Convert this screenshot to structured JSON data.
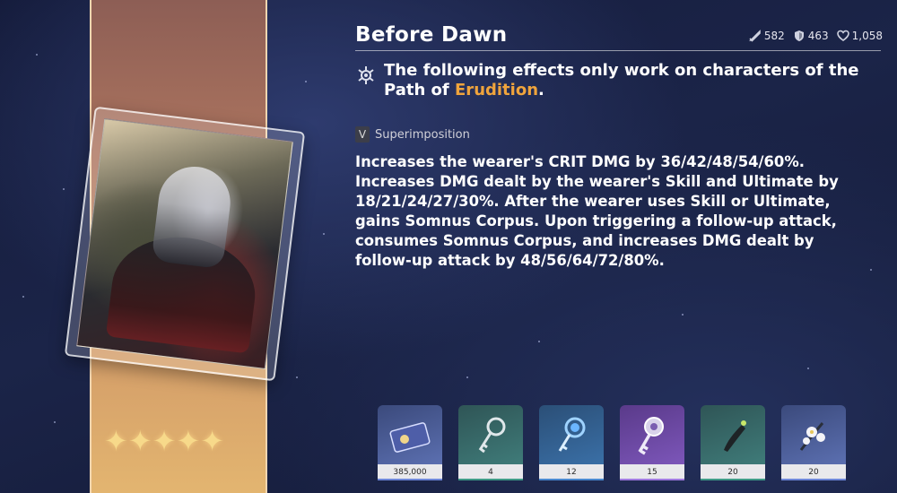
{
  "lightcone": {
    "title": "Before Dawn",
    "rarity_stars": "✦✦✦✦✦",
    "stats": [
      {
        "icon": "attack-icon",
        "value": "582"
      },
      {
        "icon": "defense-icon",
        "value": "463"
      },
      {
        "icon": "hp-heart-icon",
        "value": "1,058"
      }
    ],
    "path_note": {
      "prefix": "The following effects only work on characters of the Path of ",
      "path": "Erudition",
      "suffix": "."
    },
    "superimposition": {
      "rank": "V",
      "label": "Superimposition"
    },
    "description": "Increases the wearer's CRIT DMG by 36/42/48/54/60%. Increases DMG dealt by the wearer's Skill and Ultimate by 18/21/24/27/30%. After the wearer uses Skill or Ultimate, gains Somnus Corpus. Upon triggering a follow-up attack, consumes Somnus Corpus, and increases DMG dealt by follow-up attack by 48/56/64/72/80%."
  },
  "materials": [
    {
      "icon": "credit-card-icon",
      "count": "385,000",
      "tier": "blue"
    },
    {
      "icon": "silver-key-icon",
      "count": "4",
      "tier": "green"
    },
    {
      "icon": "blue-key-icon",
      "count": "12",
      "tier": "teal"
    },
    {
      "icon": "ornate-key-icon",
      "count": "15",
      "tier": "purple"
    },
    {
      "icon": "dark-horn-icon",
      "count": "20",
      "tier": "green"
    },
    {
      "icon": "white-flower-icon",
      "count": "20",
      "tier": "blue"
    }
  ],
  "colors": {
    "path_highlight": "#f0a43c",
    "banner_top": "#8d5e55",
    "banner_bottom": "#e3b570"
  }
}
